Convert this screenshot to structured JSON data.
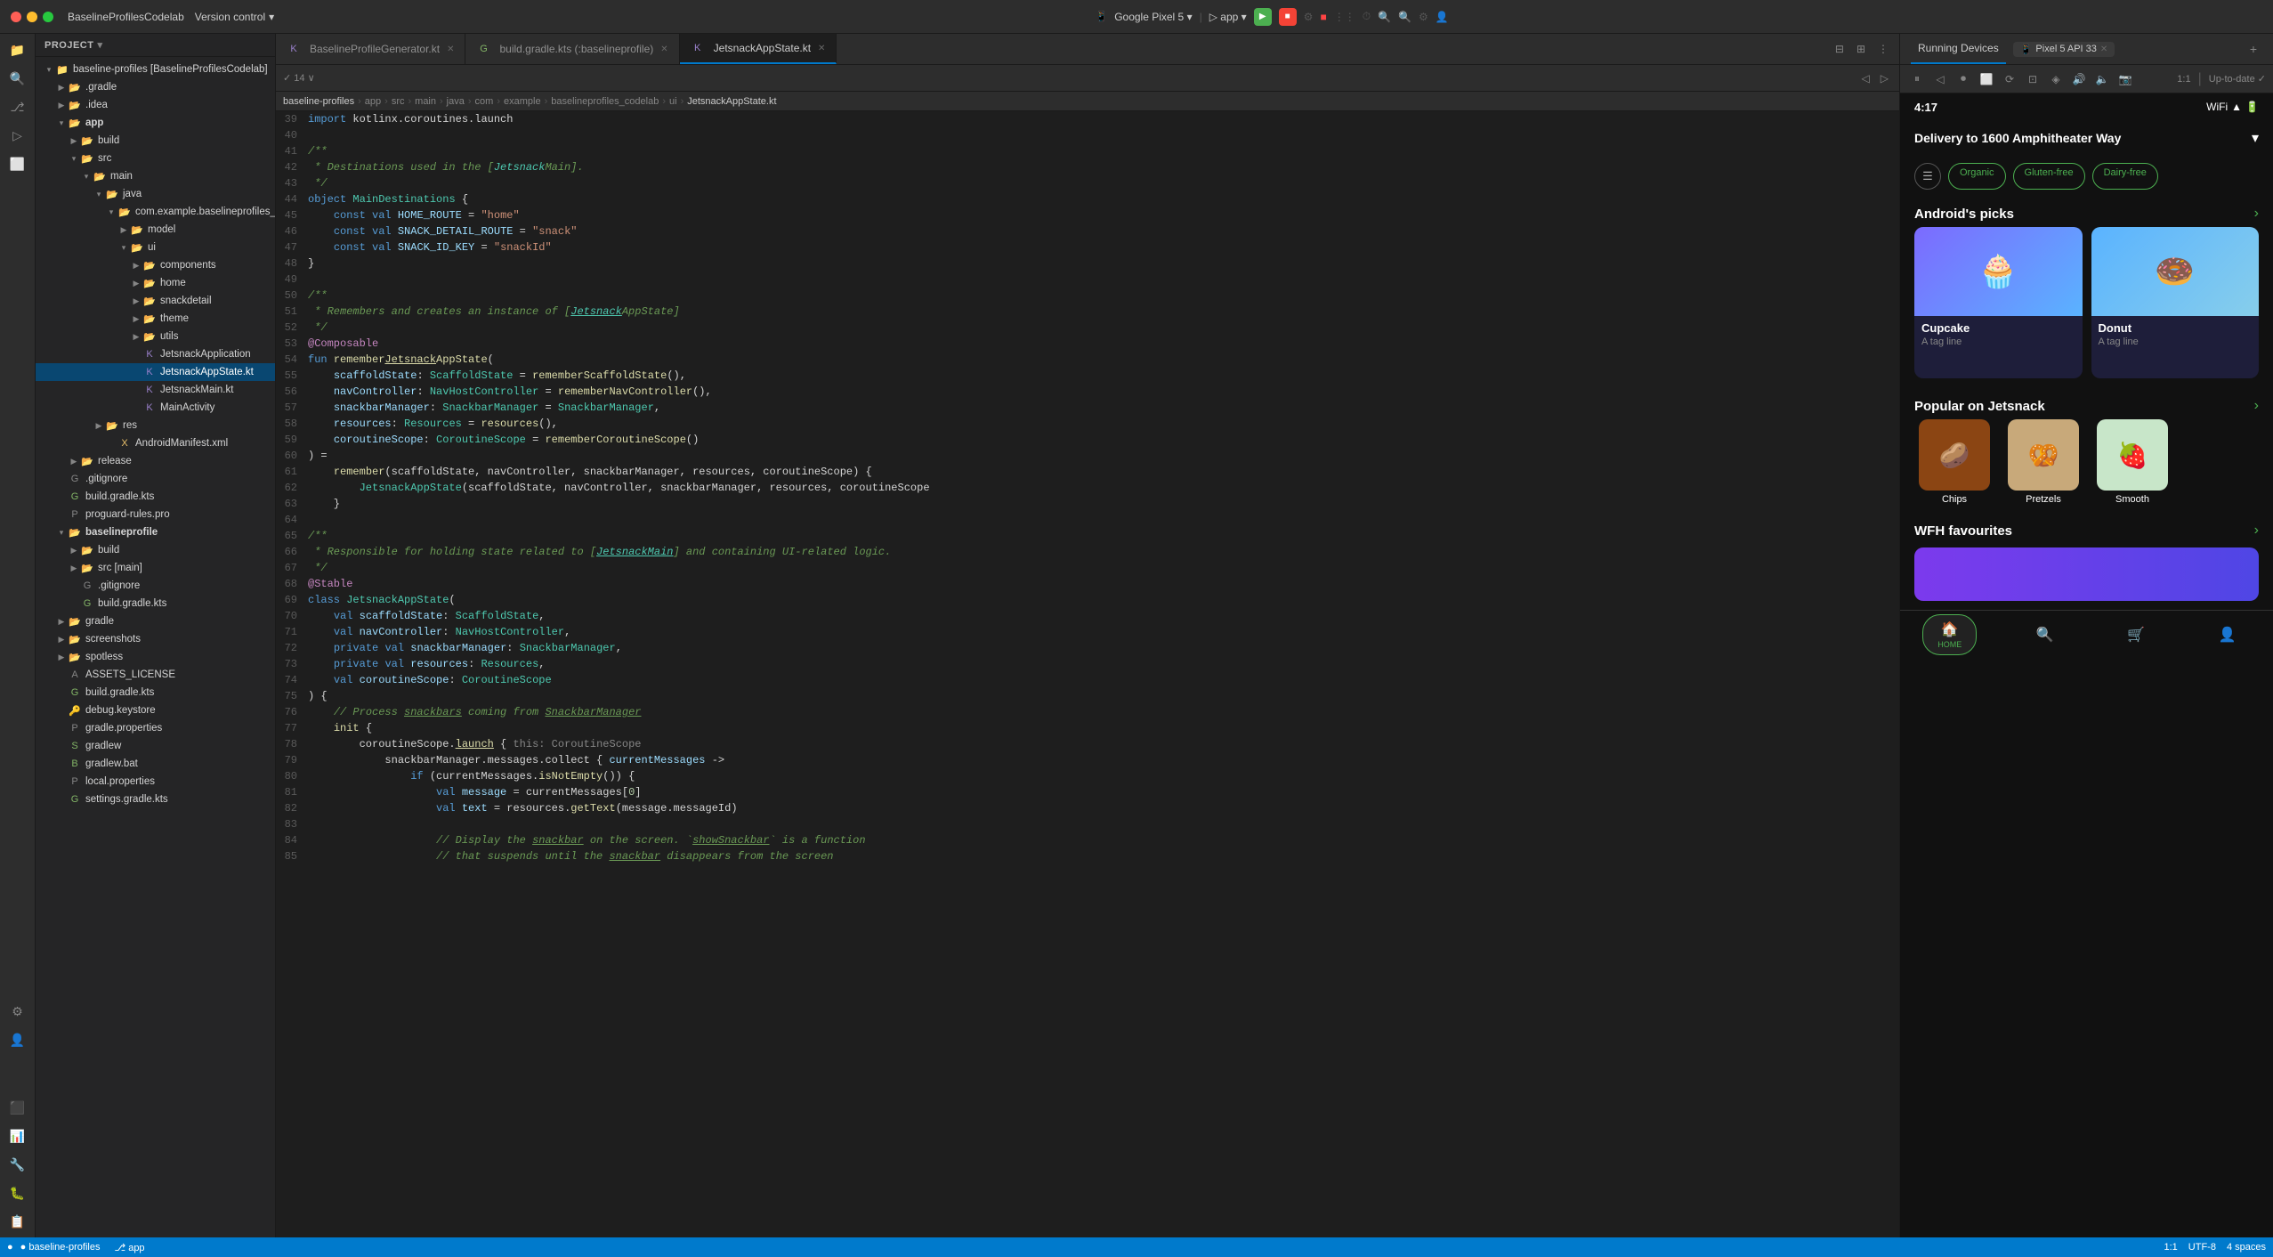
{
  "app": {
    "title": "BaselineProfilesCodelab",
    "version_control": "Version control",
    "project_label": "Project"
  },
  "tabs": {
    "items": [
      {
        "label": "BaselineProfileGenerator.kt",
        "active": false,
        "closeable": true
      },
      {
        "label": "build.gradle.kts (:baselineprofile)",
        "active": false,
        "closeable": true
      },
      {
        "label": "JetsnackAppState.kt",
        "active": true,
        "closeable": true
      }
    ]
  },
  "running_devices": {
    "panel_title": "Running Devices",
    "device_name": "Pixel 5 API 33",
    "up_to_date": "Up-to-date ✓"
  },
  "breadcrumb": {
    "items": [
      "baseline-profiles",
      "app",
      "src",
      "main",
      "java",
      "com",
      "example",
      "baselineprofiles_codelab",
      "ui",
      "JetsnackAppState.kt"
    ]
  },
  "status_bar": {
    "left": "● baseline-profiles",
    "git": "app",
    "line_col": "1:1",
    "encoding": "UTF-8",
    "indent": "4 spaces"
  },
  "phone": {
    "time": "4:17",
    "delivery_address": "Delivery to 1600 Amphitheater Way",
    "filter_chips": [
      "Organic",
      "Gluten-free",
      "Dairy-free"
    ],
    "sections": {
      "androids_picks": "Android's picks",
      "popular": "Popular on Jetsnack",
      "wfh": "WFH favourites"
    },
    "picks": [
      {
        "name": "Cupcake",
        "tagline": "A tag line",
        "emoji": "🧁"
      },
      {
        "name": "Donut",
        "tagline": "A tag line",
        "emoji": "🍩"
      }
    ],
    "popular_items": [
      {
        "name": "Chips",
        "emoji": "🥔"
      },
      {
        "name": "Pretzels",
        "emoji": "🥨"
      },
      {
        "name": "Smooth",
        "emoji": "🍓"
      }
    ],
    "nav": {
      "home": "HOME",
      "search": "🔍",
      "cart": "🛒",
      "profile": "👤"
    }
  },
  "project_tree": {
    "root": "baseline-profiles [BaselineProfilesCodelab]",
    "items": [
      {
        "level": 1,
        "type": "folder",
        "label": ".gradle",
        "expanded": false
      },
      {
        "level": 1,
        "type": "folder",
        "label": ".idea",
        "expanded": false
      },
      {
        "level": 1,
        "type": "folder",
        "label": "app",
        "expanded": true
      },
      {
        "level": 2,
        "type": "folder",
        "label": "build",
        "expanded": false
      },
      {
        "level": 2,
        "type": "folder",
        "label": "src",
        "expanded": true
      },
      {
        "level": 3,
        "type": "folder",
        "label": "main",
        "expanded": true
      },
      {
        "level": 4,
        "type": "folder",
        "label": "java",
        "expanded": true
      },
      {
        "level": 5,
        "type": "folder",
        "label": "com.example.baselineprofiles_codel",
        "expanded": true
      },
      {
        "level": 6,
        "type": "folder",
        "label": "model",
        "expanded": false
      },
      {
        "level": 6,
        "type": "folder",
        "label": "ui",
        "expanded": true
      },
      {
        "level": 7,
        "type": "folder",
        "label": "components",
        "expanded": false
      },
      {
        "level": 7,
        "type": "folder",
        "label": "home",
        "expanded": false
      },
      {
        "level": 7,
        "type": "folder",
        "label": "snackdetail",
        "expanded": false
      },
      {
        "level": 7,
        "type": "folder",
        "label": "theme",
        "expanded": false
      },
      {
        "level": 7,
        "type": "folder",
        "label": "utils",
        "expanded": false
      },
      {
        "level": 7,
        "type": "file",
        "label": "JetsnackApplication",
        "ext": "kt"
      },
      {
        "level": 7,
        "type": "file",
        "label": "JetsnackAppState.kt",
        "ext": "kt",
        "selected": true
      },
      {
        "level": 7,
        "type": "file",
        "label": "JetsnackMain.kt",
        "ext": "kt"
      },
      {
        "level": 7,
        "type": "file",
        "label": "MainActivity",
        "ext": "kt"
      },
      {
        "level": 4,
        "type": "folder",
        "label": "res",
        "expanded": false
      },
      {
        "level": 5,
        "type": "file",
        "label": "AndroidManifest.xml",
        "ext": "xml"
      },
      {
        "level": 2,
        "type": "folder",
        "label": "release",
        "expanded": false
      },
      {
        "level": 1,
        "type": "file",
        "label": ".gitignore",
        "ext": "git"
      },
      {
        "level": 1,
        "type": "file",
        "label": "build.gradle.kts",
        "ext": "gradle"
      },
      {
        "level": 1,
        "type": "file",
        "label": "proguard-rules.pro",
        "ext": "pro"
      },
      {
        "level": 1,
        "type": "folder",
        "label": "baselineprofile",
        "expanded": true
      },
      {
        "level": 2,
        "type": "folder",
        "label": "build",
        "expanded": false
      },
      {
        "level": 2,
        "type": "folder",
        "label": "src [main]",
        "expanded": false
      },
      {
        "level": 2,
        "type": "file",
        "label": ".gitignore",
        "ext": "git"
      },
      {
        "level": 2,
        "type": "file",
        "label": "build.gradle.kts",
        "ext": "gradle"
      },
      {
        "level": 1,
        "type": "file",
        "label": "gradle",
        "ext": "gradle"
      },
      {
        "level": 1,
        "type": "file",
        "label": "screenshots",
        "ext": "folder"
      },
      {
        "level": 1,
        "type": "folder",
        "label": "spotless",
        "expanded": false
      },
      {
        "level": 1,
        "type": "file",
        "label": "ASSETS_LICENSE",
        "ext": "txt"
      },
      {
        "level": 1,
        "type": "file",
        "label": "build.gradle.kts",
        "ext": "gradle"
      },
      {
        "level": 1,
        "type": "file",
        "label": "debug.keystore",
        "ext": "key"
      },
      {
        "level": 1,
        "type": "file",
        "label": "gradle.properties",
        "ext": "prop"
      },
      {
        "level": 1,
        "type": "file",
        "label": "gradlew",
        "ext": "sh"
      },
      {
        "level": 1,
        "type": "file",
        "label": "gradlew.bat",
        "ext": "bat"
      },
      {
        "level": 1,
        "type": "file",
        "label": "local.properties",
        "ext": "prop"
      },
      {
        "level": 1,
        "type": "file",
        "label": "settings.gradle.kts",
        "ext": "gradle"
      }
    ]
  },
  "code": {
    "lines": [
      {
        "n": 39,
        "text": "import kotlinx.coroutines.launch"
      },
      {
        "n": 40,
        "text": ""
      },
      {
        "n": 41,
        "text": "/**"
      },
      {
        "n": 42,
        "text": " * Destinations used in the [JetsnackMain]."
      },
      {
        "n": 43,
        "text": " */"
      },
      {
        "n": 44,
        "text": "object MainDestinations {"
      },
      {
        "n": 45,
        "text": "    const val HOME_ROUTE = \"home\""
      },
      {
        "n": 46,
        "text": "    const val SNACK_DETAIL_ROUTE = \"snack\""
      },
      {
        "n": 47,
        "text": "    const val SNACK_ID_KEY = \"snackId\""
      },
      {
        "n": 48,
        "text": "}"
      },
      {
        "n": 49,
        "text": ""
      },
      {
        "n": 50,
        "text": "/**"
      },
      {
        "n": 51,
        "text": " * Remembers and creates an instance of [JetsnackAppState]"
      },
      {
        "n": 52,
        "text": " */"
      },
      {
        "n": 53,
        "text": "@Composable"
      },
      {
        "n": 54,
        "text": "fun rememberJetsnackAppState("
      },
      {
        "n": 55,
        "text": "    scaffoldState: ScaffoldState = rememberScaffoldState(),"
      },
      {
        "n": 56,
        "text": "    navController: NavHostController = rememberNavController(),"
      },
      {
        "n": 57,
        "text": "    snackbarManager: SnackbarManager = SnackbarManager,"
      },
      {
        "n": 58,
        "text": "    resources: Resources = resources(),"
      },
      {
        "n": 59,
        "text": "    coroutineScope: CoroutineScope = rememberCoroutineScope()"
      },
      {
        "n": 60,
        "text": ") ="
      },
      {
        "n": 61,
        "text": "    remember(scaffoldState, navController, snackbarManager, resources, coroutineScope) {"
      },
      {
        "n": 62,
        "text": "        JetsnackAppState(scaffoldState, navController, snackbarManager, resources, coroutineScope"
      },
      {
        "n": 63,
        "text": "    }"
      },
      {
        "n": 64,
        "text": ""
      },
      {
        "n": 65,
        "text": "/**"
      },
      {
        "n": 66,
        "text": " * Responsible for holding state related to [JetsnackMain] and containing UI-related logic."
      },
      {
        "n": 67,
        "text": " */"
      },
      {
        "n": 68,
        "text": "@Stable"
      },
      {
        "n": 69,
        "text": "class JetsnackAppState("
      },
      {
        "n": 70,
        "text": "    val scaffoldState: ScaffoldState,"
      },
      {
        "n": 71,
        "text": "    val navController: NavHostController,"
      },
      {
        "n": 72,
        "text": "    private val snackbarManager: SnackbarManager,"
      },
      {
        "n": 73,
        "text": "    private val resources: Resources,"
      },
      {
        "n": 74,
        "text": "    val coroutineScope: CoroutineScope"
      },
      {
        "n": 75,
        "text": ") {"
      },
      {
        "n": 76,
        "text": "    // Process snackbars coming from SnackbarManager"
      },
      {
        "n": 77,
        "text": "    init {"
      },
      {
        "n": 78,
        "text": "        coroutineScope.launch { this: CoroutineScope"
      },
      {
        "n": 79,
        "text": "            snackbarManager.messages.collect { currentMessages ->"
      },
      {
        "n": 80,
        "text": "                if (currentMessages.isNotEmpty()) {"
      },
      {
        "n": 81,
        "text": "                    val message = currentMessages[0]"
      },
      {
        "n": 82,
        "text": "                    val text = resources.getText(message.messageId)"
      },
      {
        "n": 83,
        "text": ""
      },
      {
        "n": 84,
        "text": "                    // Display the snackbar on the screen. `showSnackbar` is a function"
      },
      {
        "n": 85,
        "text": "                    // that suspends until the snackbar disappears from the screen"
      }
    ]
  }
}
